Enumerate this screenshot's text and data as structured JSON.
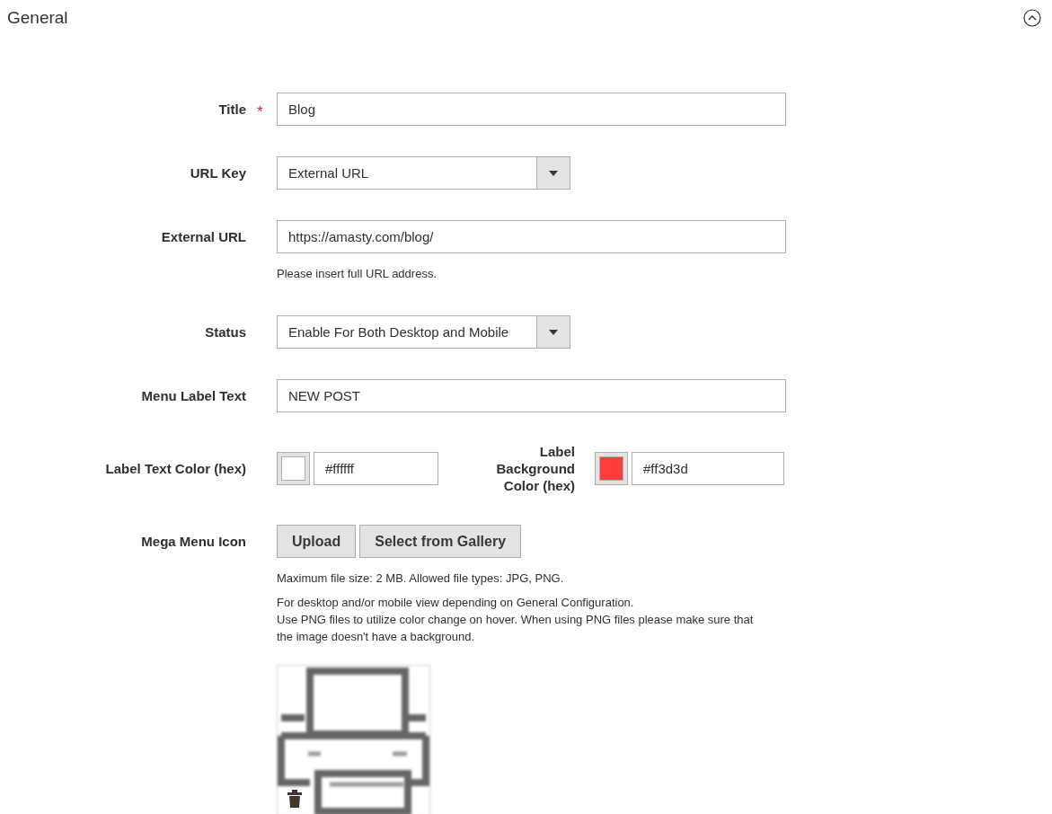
{
  "section": {
    "title": "General",
    "expanded": true
  },
  "required_mark": "*",
  "fields": [
    {
      "kind": "text",
      "label": "Title",
      "required": true,
      "value": "Blog"
    },
    {
      "kind": "select",
      "label": "URL Key",
      "required": false,
      "value": "External URL"
    },
    {
      "kind": "text",
      "label": "External URL",
      "required": false,
      "value": "https://amasty.com/blog/",
      "notes": [
        "Please insert full URL address."
      ]
    },
    {
      "kind": "select",
      "label": "Status",
      "required": false,
      "value": "Enable For Both Desktop and Mobile"
    },
    {
      "kind": "text",
      "label": "Menu Label Text",
      "required": false,
      "value": "NEW POST"
    },
    {
      "kind": "colors",
      "required": false,
      "pickers": [
        {
          "label": "Label Text Color (hex)",
          "value": "#ffffff",
          "color": "#ffffff"
        },
        {
          "label": "Label Background Color (hex)",
          "value": "#ff3d3d",
          "color": "#ff3d3d"
        }
      ]
    },
    {
      "kind": "upload",
      "label": "Mega Menu Icon",
      "required": false,
      "buttons": [
        "Upload",
        "Select from Gallery"
      ],
      "notes": [
        "Maximum file size: 2 MB. Allowed file types: JPG, PNG.",
        "For desktop and/or mobile view depending on General Configuration.\nUse PNG files to utilize color change on hover. When using PNG files please make sure that the image doesn't have a background."
      ]
    }
  ]
}
